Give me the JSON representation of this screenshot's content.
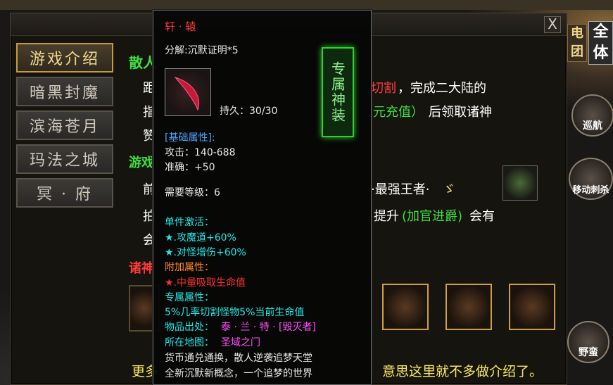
{
  "colors": {
    "accent_green": "#40e040",
    "accent_red": "#ff3a3a",
    "accent_yellow": "#f8e860"
  },
  "window": {
    "close_label": "X"
  },
  "nav": {
    "items": [
      {
        "label": "游戏介绍",
        "active": true
      },
      {
        "label": "暗黑封魔",
        "active": false
      },
      {
        "label": "滨海苍月",
        "active": false
      },
      {
        "label": "玛法之城",
        "active": false
      },
      {
        "label": "冥 · 府",
        "active": false
      }
    ]
  },
  "content": {
    "section1_title": "散人",
    "l1a": "距",
    "l1b": "切割",
    "l1c": "，完成二大陆的",
    "l2a": "指",
    "l2b": "元充值）",
    "l2c": "后领取诸神",
    "l3a": "赞",
    "section2_title": "游戏",
    "l4a": "前",
    "l4b": "·最强王者·",
    "l4c": "ゞ",
    "l5a": "拍",
    "l5b": "提升",
    "l5c": "(加官进爵)",
    "l5d": "会有",
    "l6a": "会",
    "section3_title": "诸神",
    "footer_a": "更多",
    "footer_b": "意思这里就不多做介绍了。"
  },
  "side": {
    "dian": "电",
    "tuan": "团",
    "quan": "全",
    "ti": "体",
    "xunhang": "巡航",
    "yidong": "移动刺杀",
    "yeman": "野蛮"
  },
  "tooltip": {
    "title": "轩 · 辕",
    "decompose": "分解:沉默证明*5",
    "durability": "持久：30/30",
    "exclusive_tag": "专属神装",
    "base_header": "[基础属性]:",
    "attack": "攻击：140-688",
    "accuracy": "准确：+50",
    "level_req": "需要等级：6",
    "single_header": "单件激活：",
    "single_1": "★.攻魔道+60%",
    "single_2": "★.对怪增伤+60%",
    "extra_header": "附加属性：",
    "extra_1": "★.中量吸取生命值",
    "exclusive_header": "专属属性：",
    "exclusive_1": "5%几率切割怪物5%当前生命值",
    "source_label": "物品出处：",
    "source_value": "泰 · 兰 · 特 · [毁灭者]",
    "map_label": "所在地图：",
    "map_value": "圣域之门",
    "desc_1": "货币通兑通换，散人逆袭追梦天堂",
    "desc_2": "全新沉默新概念，一个追梦的世界"
  }
}
